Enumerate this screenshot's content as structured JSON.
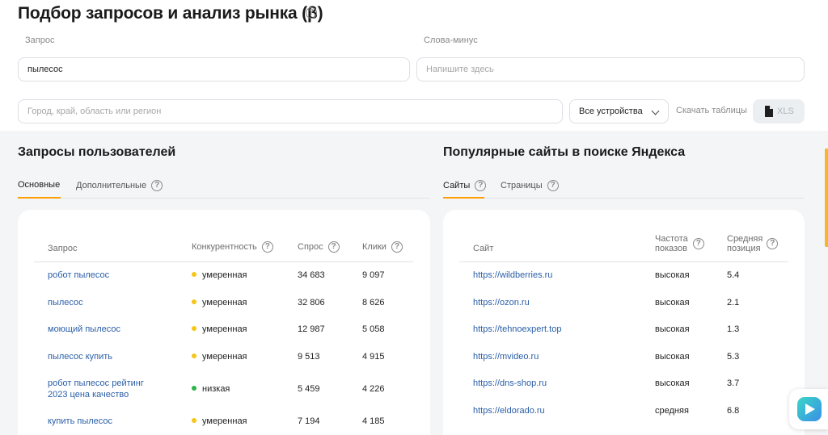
{
  "header": {
    "title": "Подбор запросов и анализ рынка (β)",
    "help_mark": "?"
  },
  "form": {
    "query_label": "Запрос",
    "query_value": "пылесос",
    "minus_label": "Слова-минус",
    "minus_placeholder": "Напишите здесь",
    "region_placeholder": "Город, край, область или регион",
    "device_select": "Все устройства",
    "download_label": "Скачать таблицы",
    "xls_button": "XLS"
  },
  "queries": {
    "title": "Запросы пользователей",
    "tabs": [
      {
        "label": "Основные",
        "active": true
      },
      {
        "label": "Дополнительные",
        "active": false
      }
    ],
    "columns": [
      "Запрос",
      "Конкурентность",
      "Спрос",
      "Клики"
    ],
    "rows": [
      {
        "query": "робот пылесос",
        "competition": "умеренная",
        "level": "moderate",
        "demand": "34 683",
        "clicks": "9 097"
      },
      {
        "query": "пылесос",
        "competition": "умеренная",
        "level": "moderate",
        "demand": "32 806",
        "clicks": "8 626"
      },
      {
        "query": "моющий пылесос",
        "competition": "умеренная",
        "level": "moderate",
        "demand": "12 987",
        "clicks": "5 058"
      },
      {
        "query": "пылесос купить",
        "competition": "умеренная",
        "level": "moderate",
        "demand": "9 513",
        "clicks": "4 915"
      },
      {
        "query_line1": "робот пылесос рейтинг",
        "query_line2": "2023 цена качество",
        "competition": "низкая",
        "level": "low",
        "demand": "5 459",
        "clicks": "4 226"
      },
      {
        "query": "купить пылесос",
        "competition": "умеренная",
        "level": "moderate",
        "demand": "7 194",
        "clicks": "4 185"
      }
    ]
  },
  "sites": {
    "title": "Популярные сайты в поиске Яндекса",
    "tabs": [
      {
        "label": "Сайты",
        "active": true
      },
      {
        "label": "Страницы",
        "active": false
      }
    ],
    "columns": {
      "site": "Сайт",
      "freq_line1": "Частота",
      "freq_line2": "показов",
      "pos_line1": "Средняя",
      "pos_line2": "позиция"
    },
    "rows": [
      {
        "site": "https://wildberries.ru",
        "frequency": "высокая",
        "position": "5.4"
      },
      {
        "site": "https://ozon.ru",
        "frequency": "высокая",
        "position": "2.1"
      },
      {
        "site": "https://tehnoexpert.top",
        "frequency": "высокая",
        "position": "1.3"
      },
      {
        "site": "https://mvideo.ru",
        "frequency": "высокая",
        "position": "5.3"
      },
      {
        "site": "https://dns-shop.ru",
        "frequency": "высокая",
        "position": "3.7"
      },
      {
        "site": "https://eldorado.ru",
        "frequency": "средняя",
        "position": "6.8"
      }
    ]
  },
  "colors": {
    "accent": "#ff9e00",
    "link": "#2a5ea8",
    "moderate": "#f5c518",
    "low": "#2eb34a"
  },
  "icons": [
    "help-icon",
    "chevron-down-icon",
    "file-icon",
    "chat-icon"
  ]
}
